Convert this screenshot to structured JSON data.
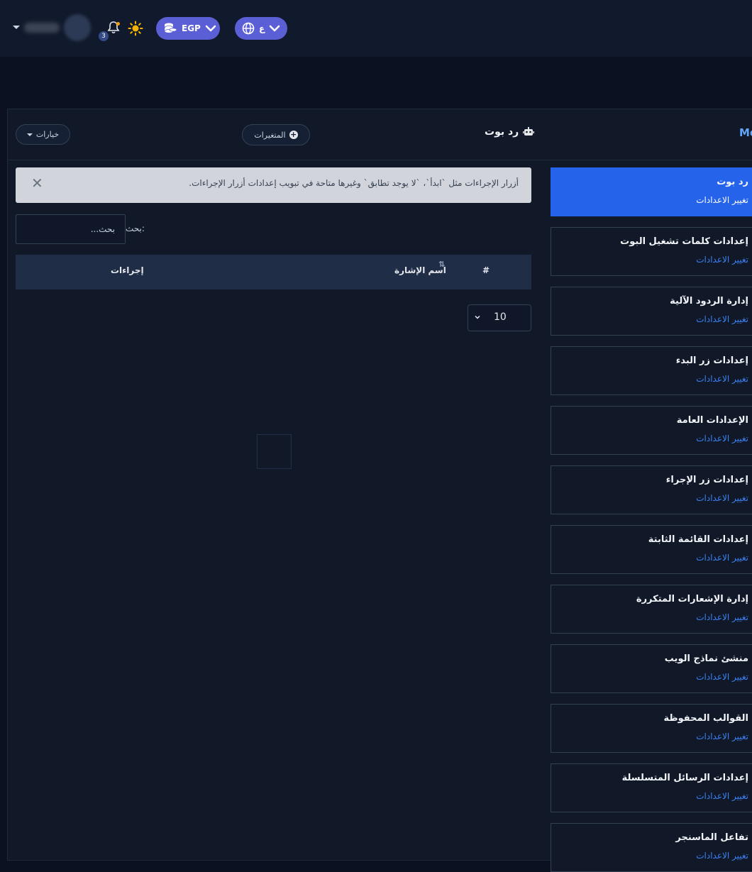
{
  "topbar": {
    "notifications_count": "3",
    "currency_label": "EGP",
    "language_label": "ع"
  },
  "card": {
    "title": "رد بوت",
    "tag": "Mo",
    "options_label": "خيارات",
    "variables_label": "المتغيرات"
  },
  "alert": {
    "text": "أزرار الإجراءات مثل `ابدأ`، `لا يوجد تطابق` وغيرها متاحة في تبويب إعدادات أزرار الإجراءات."
  },
  "search": {
    "label": "بحث:",
    "placeholder": "بحث..."
  },
  "table": {
    "headers": {
      "index": "#",
      "name": "اسم الإشارة",
      "actions": "إجراءات"
    }
  },
  "pagination": {
    "page_size": "10"
  },
  "menu": {
    "items": [
      {
        "title": "رد بوت",
        "link": "تغيير الاعدادات"
      },
      {
        "title": "إعدادات كلمات تشغيل البوت",
        "link": "تغيير الاعدادات"
      },
      {
        "title": "إدارة الردود الآلية",
        "link": "تغيير الاعدادات"
      },
      {
        "title": "إعدادات زر البدء",
        "link": "تغيير الاعدادات"
      },
      {
        "title": "الإعدادات العامة",
        "link": "تغيير الاعدادات"
      },
      {
        "title": "إعدادات زر الإجراء",
        "link": "تغيير الاعدادات"
      },
      {
        "title": "إعدادات القائمة الثابتة",
        "link": "تغيير الاعدادات"
      },
      {
        "title": "إدارة الإشعارات المتكررة",
        "link": "تغيير الاعدادات"
      },
      {
        "title": "منشئ نماذج الويب",
        "link": "تغيير الاعدادات"
      },
      {
        "title": "القوالب المحفوظة",
        "link": "تغيير الاعدادات"
      },
      {
        "title": "إعدادات الرسائل المتسلسلة",
        "link": "تغيير الاعدادات"
      },
      {
        "title": "تفاعل الماسنجر",
        "link": "تغيير الاعدادات"
      }
    ],
    "active_index": 0
  },
  "colors": {
    "accent": "#2563eb",
    "pill": "#5b5fd6",
    "link": "#3b82f6"
  }
}
